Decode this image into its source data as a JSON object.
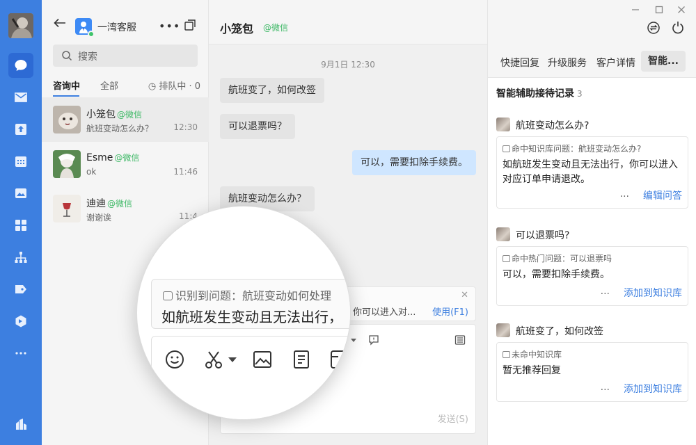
{
  "contacts": {
    "agent_name": "一湾客服",
    "search_placeholder": "搜索",
    "tabs": [
      "咨询中",
      "全部"
    ],
    "queue_label": "排队中 · 0",
    "items": [
      {
        "name": "小笼包",
        "channel": "@微信",
        "message": "航班变动怎么办？",
        "time": "12:30"
      },
      {
        "name": "Esme",
        "channel": "@微信",
        "message": "ok",
        "time": "11:46"
      },
      {
        "name": "迪迪",
        "channel": "@微信",
        "message": "谢谢诶",
        "time": "11:4"
      }
    ]
  },
  "chat": {
    "name": "小笼包",
    "channel": "@微信",
    "timestamp": "9月1日 12:30",
    "messages": [
      {
        "text": "航班变了，如何改签",
        "dir": "in"
      },
      {
        "text": "可以退票吗？",
        "dir": "in"
      },
      {
        "text": "可以，需要扣除手续费。",
        "dir": "out"
      },
      {
        "text": "航班变动怎么办？",
        "dir": "in"
      }
    ],
    "suggestion_text": "你可以进入对...",
    "suggestion_action": "使用(F1)",
    "send_label": "发送(S)"
  },
  "panel": {
    "tabs": [
      "快捷回复",
      "升级服务",
      "客户详情",
      "智能..."
    ],
    "title": "智能辅助接待记录",
    "count": "3",
    "records": [
      {
        "question": "航班变动怎么办?",
        "hint": "命中知识库问题：航班变动怎么办?",
        "answer": "如航班发生变动且无法出行，你可以进入对应订单申请退改。",
        "dots": "···",
        "action": "编辑问答"
      },
      {
        "question": "可以退票吗?",
        "hint": "命中热门问题：可以退票吗",
        "answer": "可以，需要扣除手续费。",
        "dots": "···",
        "action": "添加到知识库"
      },
      {
        "question": "航班变了，如何改签",
        "hint": "未命中知识库",
        "answer": "暂无推荐回复",
        "dots": "···",
        "action": "添加到知识库"
      }
    ]
  },
  "magnifier": {
    "hint": "识别到问题：航班变动如何处理",
    "answer": "如航班发生变动且无法出行，"
  }
}
